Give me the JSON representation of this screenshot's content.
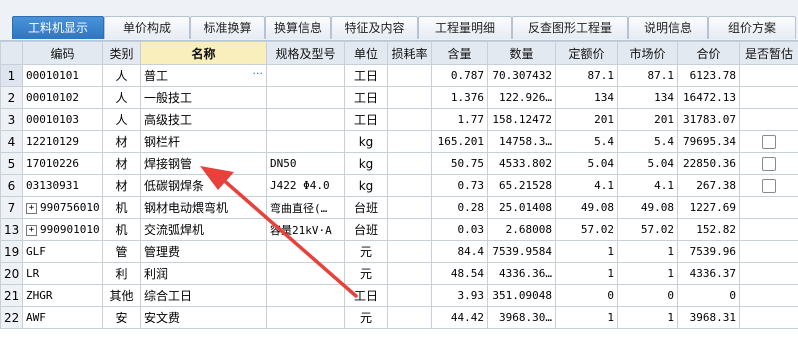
{
  "tabs": [
    {
      "label": "工料机显示",
      "active": true
    },
    {
      "label": "单价构成",
      "active": false
    },
    {
      "label": "标准换算",
      "active": false
    },
    {
      "label": "换算信息",
      "active": false
    },
    {
      "label": "特征及内容",
      "active": false
    },
    {
      "label": "工程量明细",
      "active": false
    },
    {
      "label": "反查图形工程量",
      "active": false
    },
    {
      "label": "说明信息",
      "active": false
    },
    {
      "label": "组价方案",
      "active": false
    }
  ],
  "columns": [
    "编码",
    "类别",
    "名称",
    "规格及型号",
    "单位",
    "损耗率",
    "含量",
    "数量",
    "定额价",
    "市场价",
    "合价",
    "是否暂估"
  ],
  "rows": [
    {
      "num": "1",
      "code": "00010101",
      "type": "人",
      "name": "普工",
      "spec": "",
      "unit": "工日",
      "loss": "",
      "qty": "0.787",
      "amount": "70.307432",
      "base": "87.1",
      "market": "87.1",
      "total": "6123.78",
      "tentative": false,
      "expand": false
    },
    {
      "num": "2",
      "code": "00010102",
      "type": "人",
      "name": "一般技工",
      "spec": "",
      "unit": "工日",
      "loss": "",
      "qty": "1.376",
      "amount": "122.926…",
      "base": "134",
      "market": "134",
      "total": "16472.13",
      "tentative": false,
      "expand": false
    },
    {
      "num": "3",
      "code": "00010103",
      "type": "人",
      "name": "高级技工",
      "spec": "",
      "unit": "工日",
      "loss": "",
      "qty": "1.77",
      "amount": "158.12472",
      "base": "201",
      "market": "201",
      "total": "31783.07",
      "tentative": false,
      "expand": false
    },
    {
      "num": "4",
      "code": "12210129",
      "type": "材",
      "name": "钢栏杆",
      "spec": "",
      "unit": "kg",
      "loss": "",
      "qty": "165.201",
      "amount": "14758.3…",
      "base": "5.4",
      "market": "5.4",
      "total": "79695.34",
      "tentative": true,
      "expand": false
    },
    {
      "num": "5",
      "code": "17010226",
      "type": "材",
      "name": "焊接钢管",
      "spec": "DN50",
      "unit": "kg",
      "loss": "",
      "qty": "50.75",
      "amount": "4533.802",
      "base": "5.04",
      "market": "5.04",
      "total": "22850.36",
      "tentative": true,
      "expand": false
    },
    {
      "num": "6",
      "code": "03130931",
      "type": "材",
      "name": "低碳钢焊条",
      "spec": "J422 Φ4.0",
      "unit": "kg",
      "loss": "",
      "qty": "0.73",
      "amount": "65.21528",
      "base": "4.1",
      "market": "4.1",
      "total": "267.38",
      "tentative": true,
      "expand": false
    },
    {
      "num": "7",
      "code": "990756010",
      "type": "机",
      "name": "钢材电动煨弯机",
      "spec": "弯曲直径(…",
      "unit": "台班",
      "loss": "",
      "qty": "0.28",
      "amount": "25.01408",
      "base": "49.08",
      "market": "49.08",
      "total": "1227.69",
      "tentative": false,
      "expand": true
    },
    {
      "num": "13",
      "code": "990901010",
      "type": "机",
      "name": "交流弧焊机",
      "spec": "容量21kV·A",
      "unit": "台班",
      "loss": "",
      "qty": "0.03",
      "amount": "2.68008",
      "base": "57.02",
      "market": "57.02",
      "total": "152.82",
      "tentative": false,
      "expand": true
    },
    {
      "num": "19",
      "code": "GLF",
      "type": "管",
      "name": "管理费",
      "spec": "",
      "unit": "元",
      "loss": "",
      "qty": "84.4",
      "amount": "7539.9584",
      "base": "1",
      "market": "1",
      "total": "7539.96",
      "tentative": false,
      "expand": false
    },
    {
      "num": "20",
      "code": "LR",
      "type": "利",
      "name": "利润",
      "spec": "",
      "unit": "元",
      "loss": "",
      "qty": "48.54",
      "amount": "4336.36…",
      "base": "1",
      "market": "1",
      "total": "4336.37",
      "tentative": false,
      "expand": false
    },
    {
      "num": "21",
      "code": "ZHGR",
      "type": "其他",
      "name": "综合工日",
      "spec": "",
      "unit": "工日",
      "loss": "",
      "qty": "3.93",
      "amount": "351.09048",
      "base": "0",
      "market": "0",
      "total": "0",
      "tentative": false,
      "expand": false
    },
    {
      "num": "22",
      "code": "AWF",
      "type": "安",
      "name": "安文费",
      "spec": "",
      "unit": "元",
      "loss": "",
      "qty": "44.42",
      "amount": "3968.30…",
      "base": "1",
      "market": "1",
      "total": "3968.31",
      "tentative": false,
      "expand": false
    }
  ],
  "colors": {
    "tab_active": "#2e76c1",
    "header_highlight": "#f8efbc",
    "annotation_arrow": "#e8413c"
  }
}
